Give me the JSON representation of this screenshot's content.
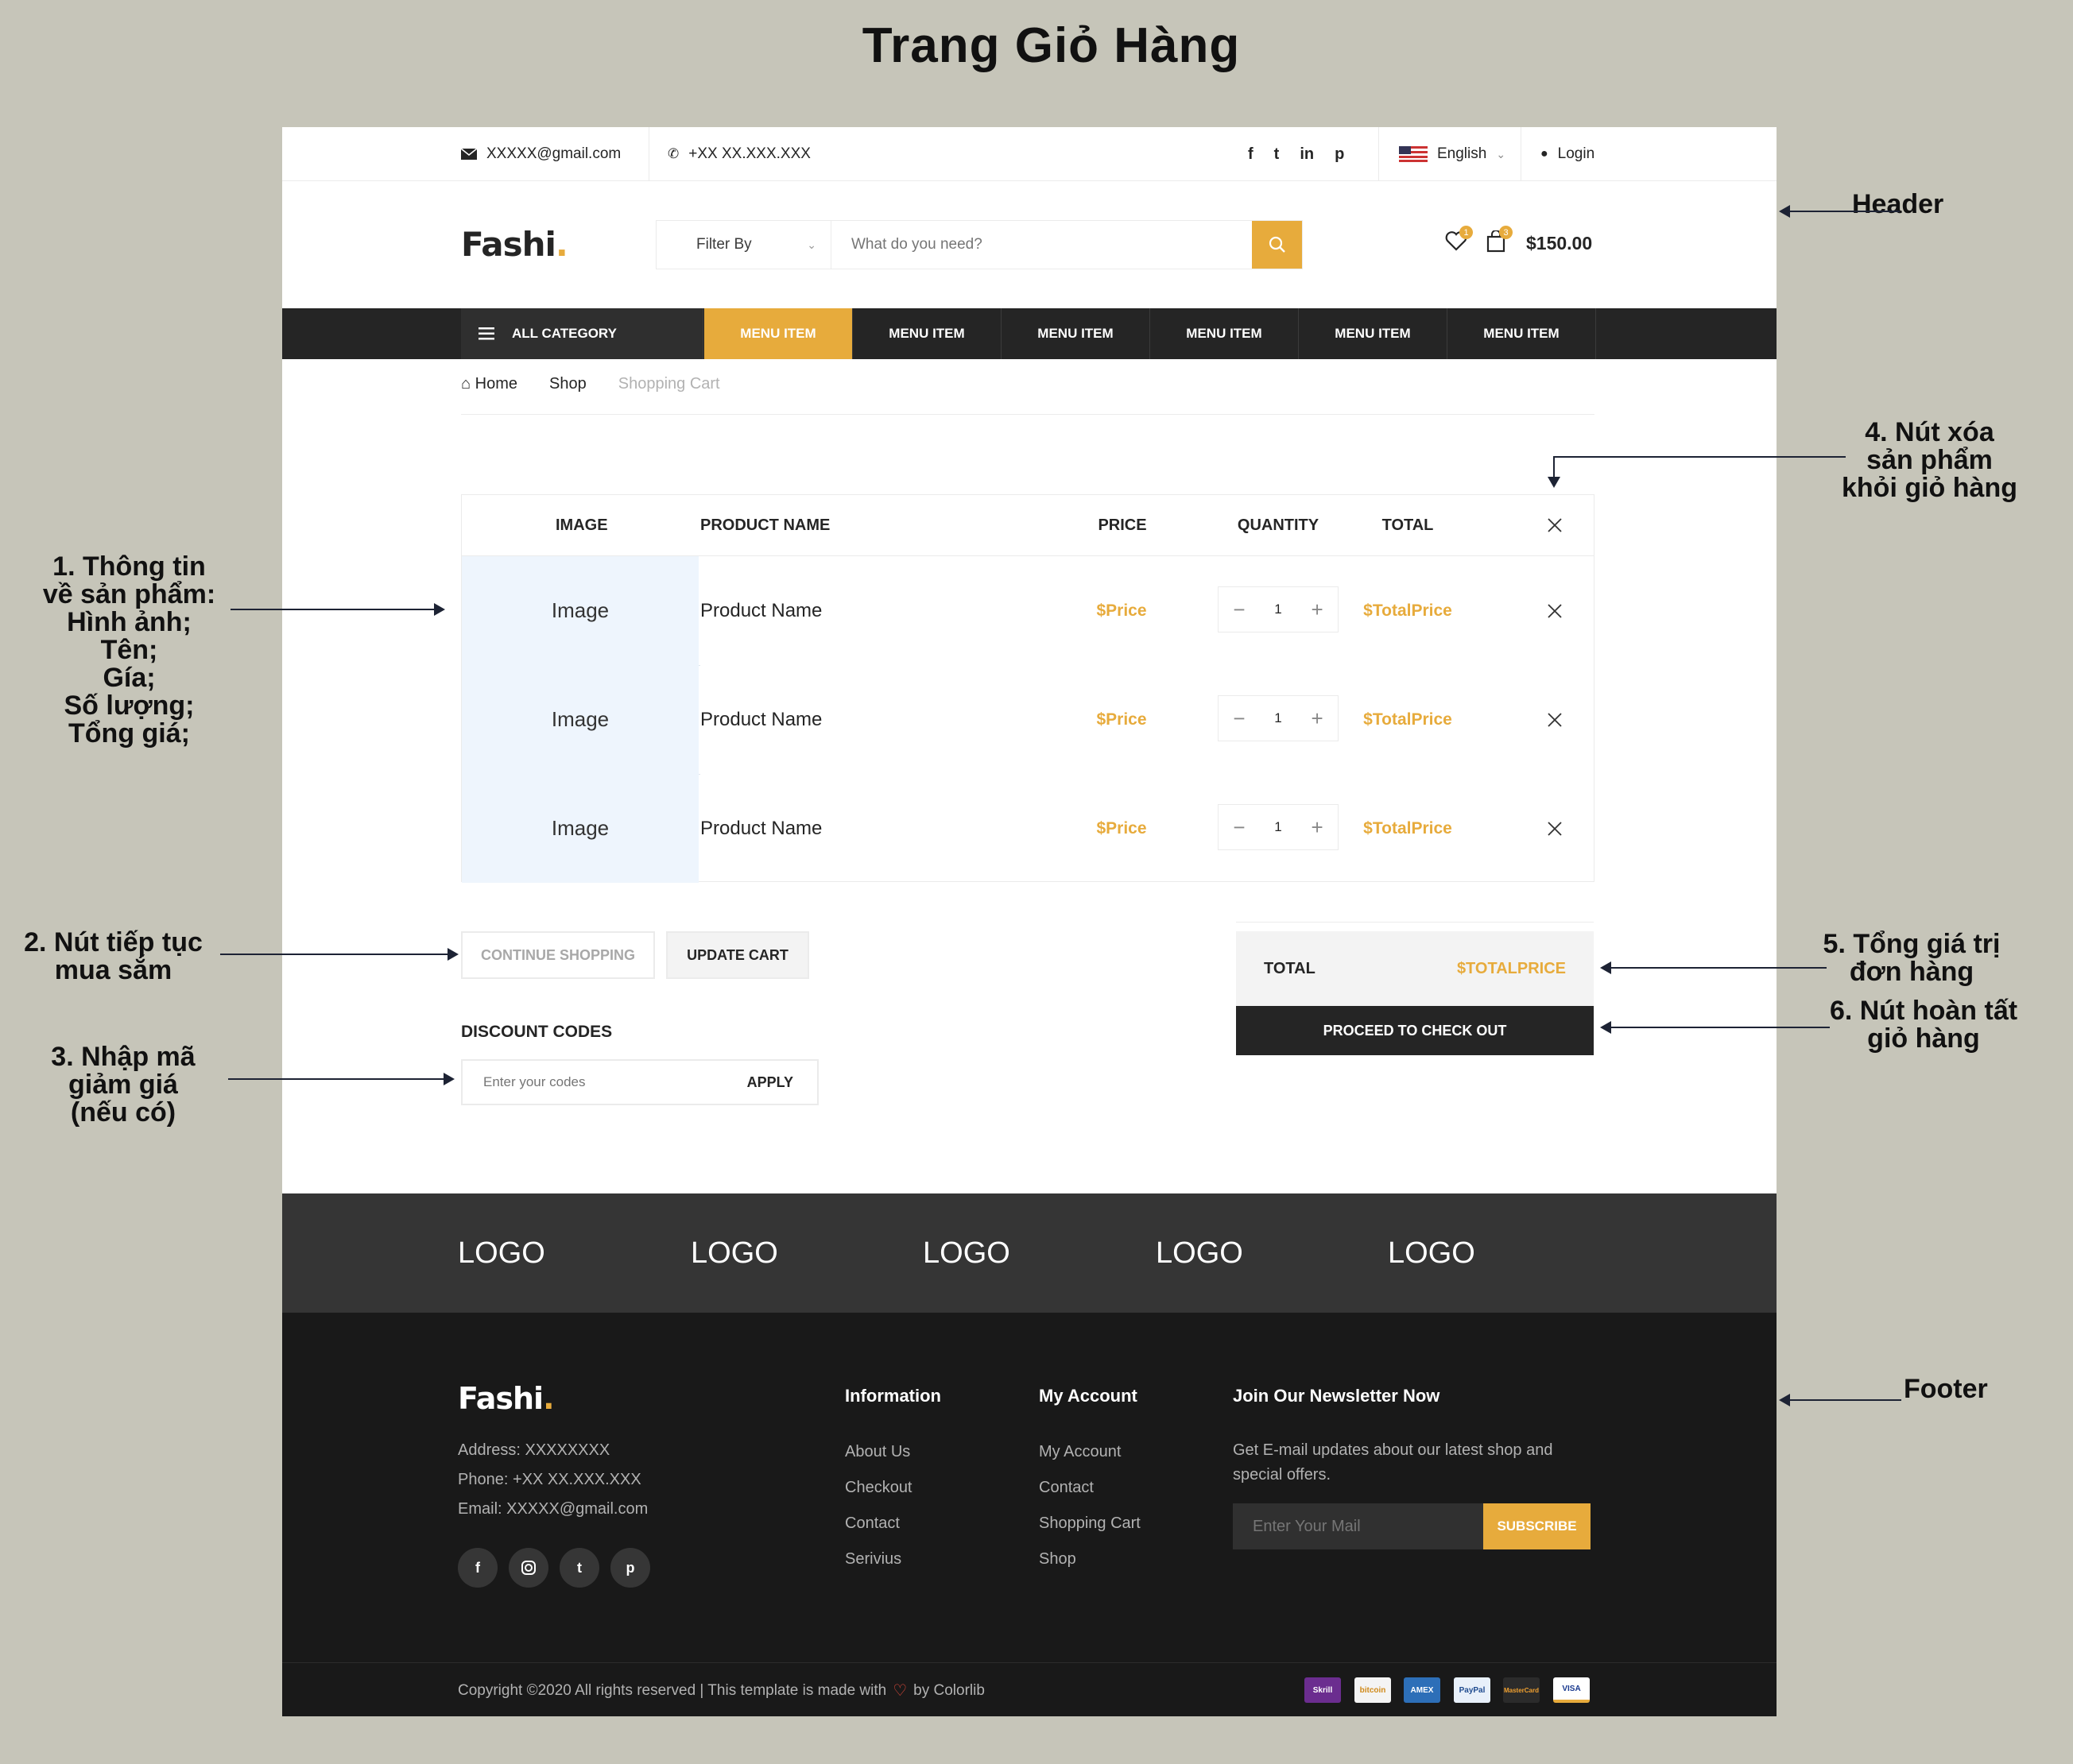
{
  "page_title": "Trang Giỏ Hàng",
  "topbar": {
    "email": "XXXXX@gmail.com",
    "phone": "+XX XX.XXX.XXX",
    "language": "English",
    "login": "Login"
  },
  "header": {
    "logo_text": "Fashi",
    "logo_dot": ".",
    "filter_label": "Filter By",
    "search_placeholder": "What do you need?",
    "wishlist_count": "1",
    "cart_count": "3",
    "cart_total": "$150.00"
  },
  "nav": {
    "all_category": "ALL CATEGORY",
    "items": [
      "MENU ITEM",
      "MENU ITEM",
      "MENU ITEM",
      "MENU ITEM",
      "MENU ITEM",
      "MENU ITEM"
    ]
  },
  "breadcrumb": [
    "Home",
    "Shop",
    "Shopping Cart"
  ],
  "cart": {
    "headers": {
      "image": "IMAGE",
      "product": "PRODUCT NAME",
      "price": "PRICE",
      "quantity": "QUANTITY",
      "total": "TOTAL"
    },
    "rows": [
      {
        "image": "Image",
        "name": "Product Name",
        "price": "$Price",
        "qty": "1",
        "total": "$TotalPrice"
      },
      {
        "image": "Image",
        "name": "Product Name",
        "price": "$Price",
        "qty": "1",
        "total": "$TotalPrice"
      },
      {
        "image": "Image",
        "name": "Product Name",
        "price": "$Price",
        "qty": "1",
        "total": "$TotalPrice"
      }
    ],
    "minus": "−",
    "plus": "+"
  },
  "actions": {
    "continue_shopping": "CONTINUE SHOPPING",
    "update_cart": "UPDATE CART"
  },
  "discount": {
    "label": "DISCOUNT CODES",
    "placeholder": "Enter your codes",
    "apply": "APPLY"
  },
  "summary": {
    "total_label": "TOTAL",
    "total_value": "$TOTALPRICE",
    "checkout": "PROCEED TO CHECK OUT"
  },
  "partner_logos": [
    "LOGO",
    "LOGO",
    "LOGO",
    "LOGO",
    "LOGO"
  ],
  "footer": {
    "logo_text": "Fashi",
    "logo_dot": ".",
    "address": "Address: XXXXXXXX",
    "phone": "Phone: +XX XX.XXX.XXX",
    "email": "Email: XXXXX@gmail.com",
    "information": {
      "title": "Information",
      "links": [
        "About Us",
        "Checkout",
        "Contact",
        "Serivius"
      ]
    },
    "my_account": {
      "title": "My Account",
      "links": [
        "My Account",
        "Contact",
        "Shopping Cart",
        "Shop"
      ]
    },
    "newsletter": {
      "title": "Join Our Newsletter Now",
      "text_line1": "Get E-mail updates about our latest shop and",
      "text_line2": "special offers.",
      "placeholder": "Enter Your Mail",
      "subscribe": "SUBSCRIBE"
    },
    "copyright_pre": "Copyright ©2020 All rights reserved | This template is made with",
    "copyright_post": "by Colorlib",
    "payments": [
      "Skrill",
      "bitcoin",
      "AMEX",
      "PayPal",
      "MasterCard",
      "VISA"
    ]
  },
  "annotations": {
    "header": "Header",
    "footer": "Footer",
    "a1": [
      "1. Thông tin",
      "về sản phẩm:",
      "Hình ảnh;",
      "Tên;",
      "Gía;",
      "Số lượng;",
      "Tổng giá;"
    ],
    "a2": [
      "2. Nút tiếp tục",
      "mua sắm"
    ],
    "a3": [
      "3. Nhập mã",
      "giảm giá",
      "(nếu có)"
    ],
    "a4": [
      "4. Nút xóa",
      "sản phẩm",
      "khỏi giỏ hàng"
    ],
    "a5": [
      "5. Tổng giá trị",
      "đơn hàng"
    ],
    "a6": [
      "6. Nút hoàn tất",
      "giỏ hàng"
    ]
  },
  "colors": {
    "accent": "#e7ab3c",
    "dark": "#252525",
    "footer": "#191919",
    "logos_band": "#353535",
    "background": "#c6c5b9"
  }
}
